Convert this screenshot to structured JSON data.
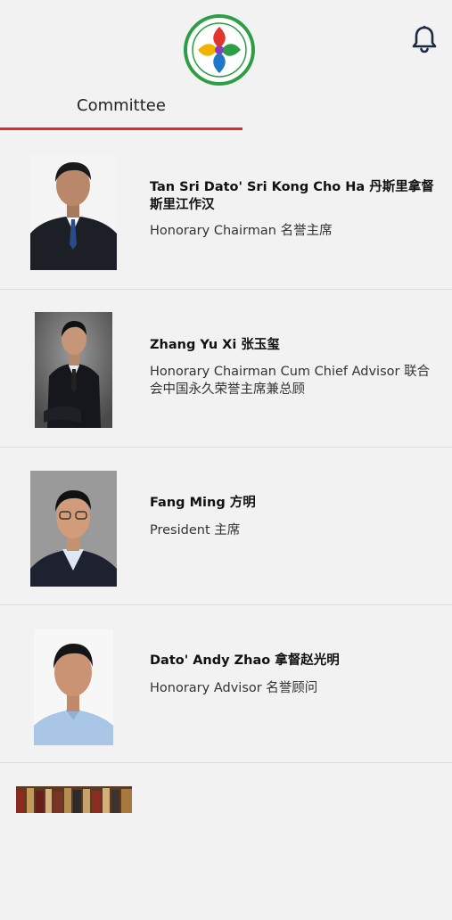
{
  "header": {
    "logo_icon": "association-logo",
    "notification_icon": "bell-icon"
  },
  "tabs": [
    {
      "label": "Committee",
      "active": true
    }
  ],
  "members": [
    {
      "name": "Tan Sri Dato' Sri Kong Cho Ha 丹斯里拿督斯里江作汉",
      "title": "Honorary Chairman 名誉主席"
    },
    {
      "name": "Zhang Yu Xi 张玉玺",
      "title": "Honorary Chairman Cum Chief Advisor 联合会中国永久荣誉主席兼总顾"
    },
    {
      "name": "Fang Ming 方明",
      "title": "President 主席"
    },
    {
      "name": "Dato' Andy Zhao 拿督赵光明",
      "title": "Honorary Advisor 名誉顾问"
    }
  ],
  "colors": {
    "accent": "#e02a2a",
    "background": "#f2f2f2",
    "logo_green": "#2e9e45"
  }
}
